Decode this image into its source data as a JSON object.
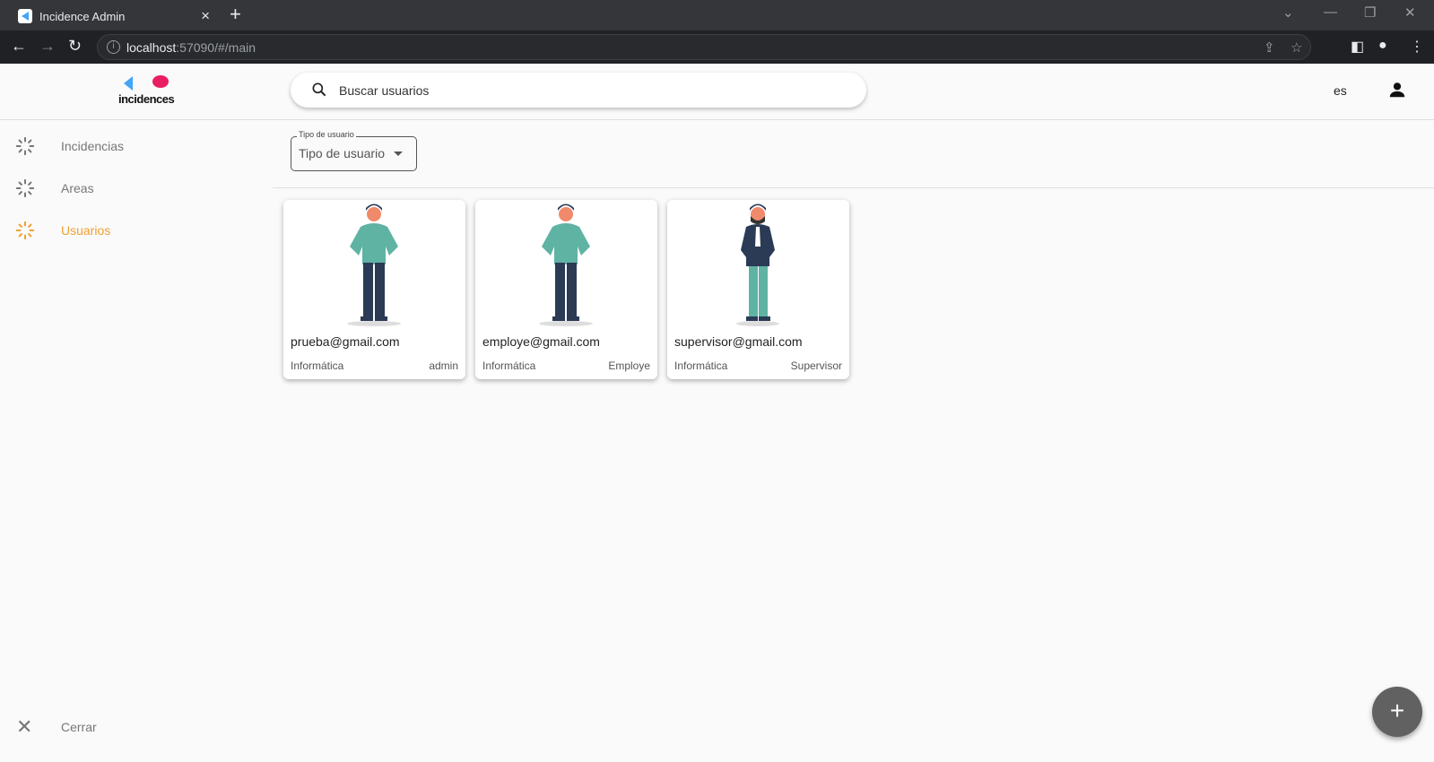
{
  "browser": {
    "tab_title": "Incidence Admin",
    "url_host": "localhost",
    "url_path": ":57090/#/main"
  },
  "header": {
    "logo_text": "incidences",
    "search_placeholder": "Buscar usuarios",
    "language": "es"
  },
  "sidebar": {
    "items": [
      {
        "label": "Incidencias",
        "active": false
      },
      {
        "label": "Areas",
        "active": false
      },
      {
        "label": "Usuarios",
        "active": true
      }
    ],
    "close_label": "Cerrar"
  },
  "filter": {
    "legend": "Tipo de usuario",
    "value": "Tipo de usuario"
  },
  "users": [
    {
      "email": "prueba@gmail.com",
      "department": "Informática",
      "role": "admin"
    },
    {
      "email": "employe@gmail.com",
      "department": "Informática",
      "role": "Employe"
    },
    {
      "email": "supervisor@gmail.com",
      "department": "Informática",
      "role": "Supervisor"
    }
  ],
  "colors": {
    "accent": "#f0a030",
    "fab": "#616161"
  }
}
